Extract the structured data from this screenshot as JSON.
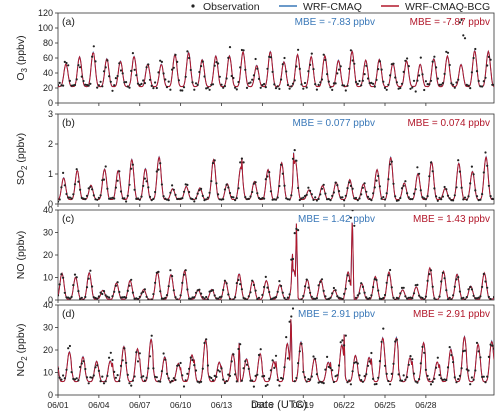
{
  "legend": {
    "items": [
      {
        "label": "Observation",
        "kind": "dot",
        "color": "#222222"
      },
      {
        "label": "WRF-CMAQ",
        "kind": "line",
        "color": "#3a78b8"
      },
      {
        "label": "WRF-CMAQ-BCG",
        "kind": "line",
        "color": "#b2182b"
      }
    ]
  },
  "colors": {
    "observation": "#222222",
    "wrf_cmaq": "#3a78b8",
    "wrf_cmaq_bcg": "#b2182b"
  },
  "chart_data": [
    {
      "type": "line",
      "panel_label": "(a)",
      "ylabel": "O",
      "ylabel_sub": "3",
      "ylabel_unit": " (ppbv)",
      "ylim": [
        0,
        120
      ],
      "yticks": [
        "0",
        "20",
        "40",
        "60",
        "80",
        "100",
        "120"
      ],
      "x_range_days": [
        0,
        32
      ],
      "annotations": [
        {
          "text": "MBE = -7.83 ppbv",
          "color": "#3a78b8"
        },
        {
          "text": "MBE = -7.87 ppbv",
          "color": "#b2182b"
        }
      ],
      "series_params": {
        "base": 22,
        "amp_low": 28,
        "amp_high": 48,
        "period": 1.0,
        "peak_hour": 14,
        "obs_bias": 8,
        "spikes": [
          {
            "day": 29.6,
            "value": 112
          },
          {
            "day": 29.8,
            "value": 105
          }
        ]
      }
    },
    {
      "type": "line",
      "panel_label": "(b)",
      "ylabel": "SO",
      "ylabel_sub": "2",
      "ylabel_unit": " (ppbv)",
      "ylim": [
        0,
        3
      ],
      "yticks": [
        "0",
        "1",
        "2",
        "3"
      ],
      "x_range_days": [
        0,
        32
      ],
      "annotations": [
        {
          "text": "MBE = 0.077 ppbv",
          "color": "#3a78b8"
        },
        {
          "text": "MBE = 0.074 ppbv",
          "color": "#b2182b"
        }
      ],
      "series_params": {
        "base": 0.15,
        "amp_low": 0.3,
        "amp_high": 1.5,
        "period": 1.0,
        "peak_hour": 10,
        "obs_bias": 0.1,
        "spikes": [
          {
            "day": 13.5,
            "value": 1.55
          },
          {
            "day": 17.3,
            "value": 1.85
          }
        ]
      }
    },
    {
      "type": "line",
      "panel_label": "(c)",
      "ylabel": "NO",
      "ylabel_sub": "",
      "ylabel_unit": " (ppbv)",
      "ylim": [
        0,
        40
      ],
      "yticks": [
        "0",
        "10",
        "20",
        "30",
        "40"
      ],
      "x_range_days": [
        0,
        32
      ],
      "annotations": [
        {
          "text": "MBE = 1.42 ppbv",
          "color": "#3a78b8"
        },
        {
          "text": "MBE = 1.43 ppbv",
          "color": "#b2182b"
        }
      ],
      "series_params": {
        "base": 0.3,
        "amp_low": 4,
        "amp_high": 14,
        "period": 1.0,
        "peak_hour": 7,
        "obs_bias": 1.5,
        "spikes": [
          {
            "day": 17.5,
            "value": 34
          },
          {
            "day": 21.6,
            "value": 40
          },
          {
            "day": 17.2,
            "value": 22
          }
        ]
      }
    },
    {
      "type": "line",
      "panel_label": "(d)",
      "ylabel": "NO",
      "ylabel_sub": "2",
      "ylabel_unit": " (ppbv)",
      "ylim": [
        0,
        40
      ],
      "yticks": [
        "0",
        "10",
        "20",
        "30",
        "40"
      ],
      "x_range_days": [
        0,
        32
      ],
      "annotations": [
        {
          "text": "MBE = 2.91 ppbv",
          "color": "#3a78b8"
        },
        {
          "text": "MBE = 2.91 ppbv",
          "color": "#b2182b"
        }
      ],
      "series_params": {
        "base": 6,
        "amp_low": 8,
        "amp_high": 20,
        "period": 1.0,
        "peak_hour": 20,
        "obs_bias": 3,
        "spikes": [
          {
            "day": 17.1,
            "value": 39
          },
          {
            "day": 13.3,
            "value": 25
          },
          {
            "day": 21.0,
            "value": 27
          }
        ]
      }
    }
  ],
  "xaxis": {
    "label": "Date (UTC)",
    "ticks": [
      {
        "day": 0,
        "label": "06/01"
      },
      {
        "day": 3,
        "label": "06/04"
      },
      {
        "day": 6,
        "label": "06/07"
      },
      {
        "day": 9,
        "label": "06/10"
      },
      {
        "day": 12,
        "label": "06/13"
      },
      {
        "day": 15,
        "label": "06/16"
      },
      {
        "day": 18,
        "label": "06/19"
      },
      {
        "day": 21,
        "label": "06/22"
      },
      {
        "day": 24,
        "label": "06/25"
      },
      {
        "day": 27,
        "label": "06/28"
      }
    ]
  }
}
